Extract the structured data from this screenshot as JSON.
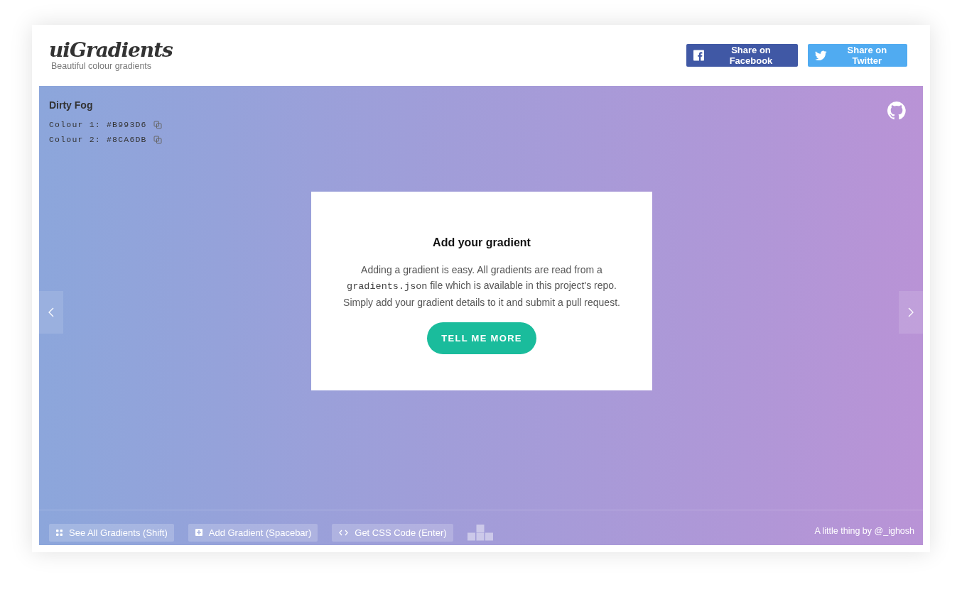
{
  "header": {
    "logo": "uiGradients",
    "tagline": "Beautiful colour gradients",
    "share_buttons": [
      {
        "kind": "facebook",
        "label": "Share on Facebook"
      },
      {
        "kind": "twitter",
        "label": "Share on Twitter"
      }
    ]
  },
  "gradient": {
    "name": "Dirty Fog",
    "colours": [
      {
        "label": "Colour 1: #B993D6",
        "color": "#b993d6"
      },
      {
        "label": "Colour 2: #8CA6DB",
        "color": "#8ca6db"
      }
    ]
  },
  "dialog": {
    "title": "Add your gradient",
    "body": [
      {
        "kind": "text",
        "text": "Adding a gradient is easy. All gradients are read from a "
      },
      {
        "kind": "code",
        "text": "gradients.json"
      },
      {
        "kind": "text",
        "text": " file which is available in this project's repo. Simply add your gradient details to it and submit a pull request."
      }
    ],
    "button": "TELL ME MORE"
  },
  "toolbar": [
    {
      "kind": "grid",
      "label": "See All Gradients (Shift)"
    },
    {
      "kind": "plus",
      "label": "Add Gradient (Spacebar)"
    },
    {
      "kind": "code",
      "label": "Get CSS Code (Enter)"
    }
  ],
  "credit": "A little thing by @_ighosh"
}
